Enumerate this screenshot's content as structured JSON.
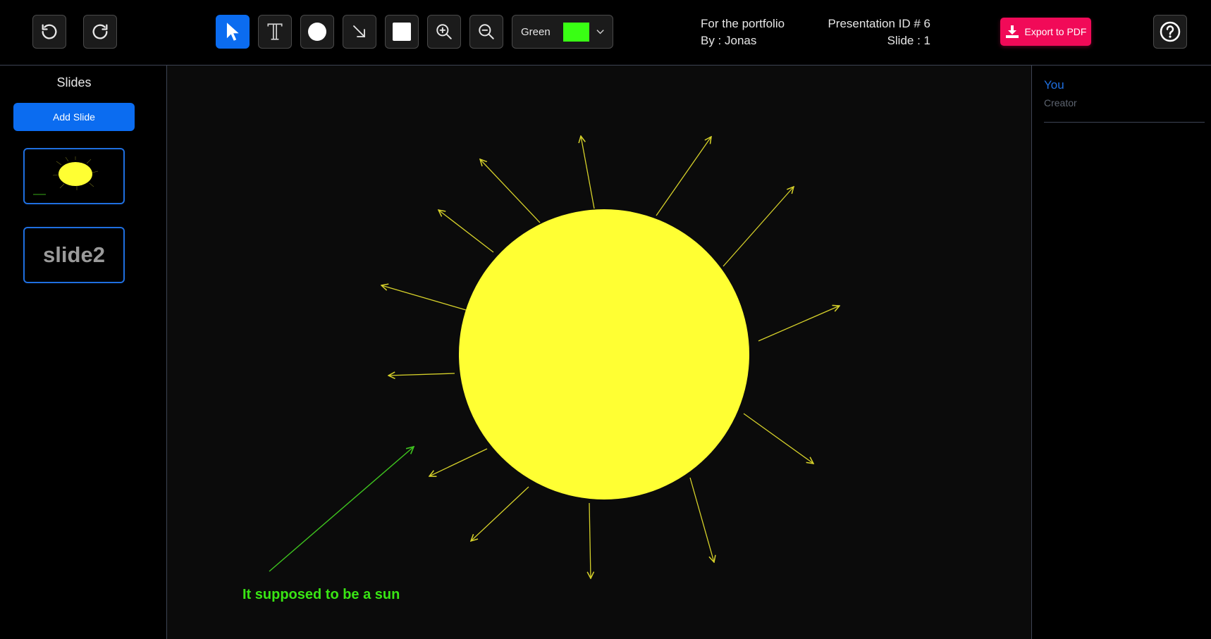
{
  "toolbar": {
    "color_label": "Green",
    "color_value": "#39ff14",
    "export_label": "Export to PDF",
    "icons": [
      "undo-icon",
      "redo-icon",
      "pointer-icon",
      "text-icon",
      "circle-icon",
      "arrow-icon",
      "square-icon",
      "zoom-in-icon",
      "zoom-out-icon",
      "help-icon"
    ]
  },
  "presentation": {
    "title": "For the portfolio",
    "author": "By : Jonas",
    "id_label": "Presentation ID # 6",
    "slide_label": "Slide : 1"
  },
  "sidebar": {
    "title": "Slides",
    "add_label": "Add Slide",
    "slides": [
      {
        "preview": "sun drawing"
      },
      {
        "label": "slide2"
      }
    ]
  },
  "canvas": {
    "caption": "It supposed to be a sun",
    "sun_color": "#ffff33",
    "ray_color": "#d6d12a",
    "caption_color": "#39e514"
  },
  "collaborators": [
    {
      "name": "You",
      "role": "Creator"
    }
  ],
  "colors": {
    "accent": "#0b6cf0",
    "export": "#f10a58",
    "border": "#3d4454"
  }
}
